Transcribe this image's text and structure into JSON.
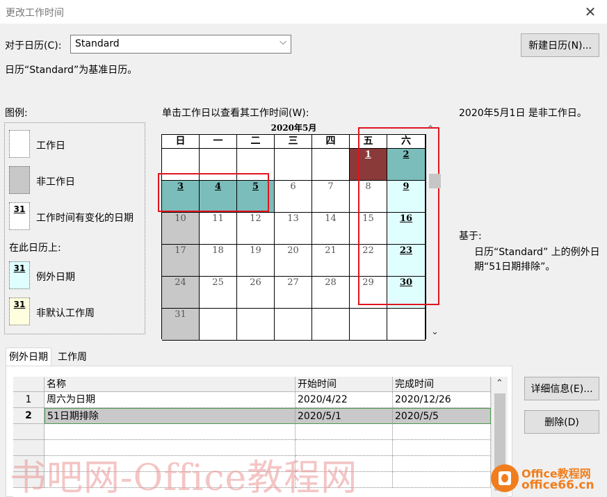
{
  "window": {
    "title": "更改工作时间"
  },
  "calendar_for": {
    "label": "对于日历(C):",
    "value": "Standard"
  },
  "new_calendar_button": "新建日历(N)...",
  "base_note": "日历“Standard”为基准日历。",
  "legend": {
    "title": "图例:",
    "items": [
      {
        "label": "工作日",
        "swatch": ""
      },
      {
        "label": "非工作日",
        "swatch": ""
      },
      {
        "label": "工作时间有变化的日期",
        "swatch": "31"
      }
    ],
    "on_this_calendar": "在此日历上:",
    "calendar_items": [
      {
        "label": "例外日期",
        "swatch": "31"
      },
      {
        "label": "非默认工作周",
        "swatch": "31"
      }
    ]
  },
  "calendar": {
    "instruction": "单击工作日以查看其工作时间(W):",
    "month_title": "2020年5月",
    "weekdays": [
      "日",
      "一",
      "二",
      "三",
      "四",
      "五",
      "六"
    ],
    "weeks": [
      [
        "",
        "",
        "",
        "",
        "",
        "1",
        "2"
      ],
      [
        "3",
        "4",
        "5",
        "6",
        "7",
        "8",
        "9"
      ],
      [
        "10",
        "11",
        "12",
        "13",
        "14",
        "15",
        "16"
      ],
      [
        "17",
        "18",
        "19",
        "20",
        "21",
        "22",
        "23"
      ],
      [
        "24",
        "25",
        "26",
        "27",
        "28",
        "29",
        "30"
      ],
      [
        "31",
        "",
        "",
        "",
        "",
        "",
        ""
      ]
    ]
  },
  "status": {
    "selected_info": "2020年5月1日 是非工作日。",
    "based_on_label": "基于:",
    "based_on_text": "日历“Standard” 上的例外日期“51日期排除”。"
  },
  "tabs": [
    "例外日期",
    "工作周"
  ],
  "exceptions_table": {
    "columns": [
      "名称",
      "开始时间",
      "完成时间"
    ],
    "rows": [
      {
        "num": "1",
        "name": "周六为日期",
        "start": "2020/4/22",
        "finish": "2020/12/26"
      },
      {
        "num": "2",
        "name": "51日期排除",
        "start": "2020/5/1",
        "finish": "2020/5/5"
      }
    ]
  },
  "buttons": {
    "details": "详细信息(E)...",
    "delete": "删除(D)"
  },
  "watermark": "书吧网-Office教程网",
  "logo": {
    "line1": "Office教程网",
    "line2": "office66.cn"
  },
  "colors": {
    "exception": "#dffffe",
    "teal": "#7bbdbb",
    "selected": "#8b3a3a",
    "nonworking": "#c8c8c8",
    "highlight_box": "#e0141e"
  }
}
